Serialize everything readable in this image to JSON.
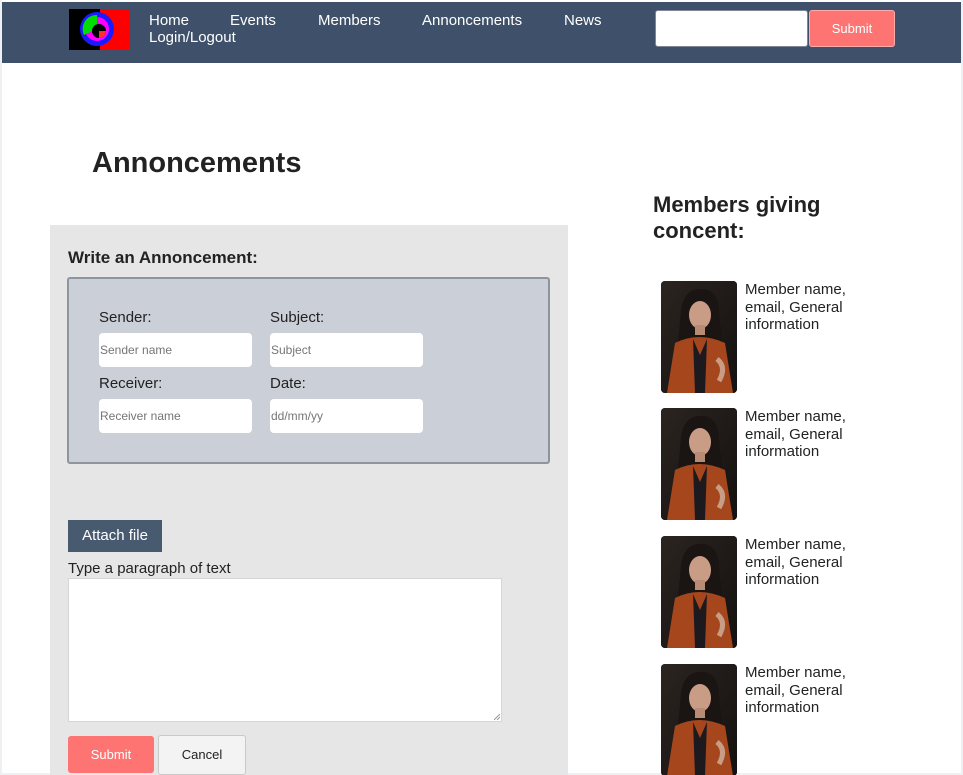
{
  "nav": {
    "links": [
      "Home",
      "Events",
      "Members",
      "Annoncements",
      "News",
      "Login/Logout"
    ],
    "submit_label": "Submit",
    "search_value": ""
  },
  "page": {
    "title": "Annoncements"
  },
  "form": {
    "title": "Write an Annoncement:",
    "sender_label": "Sender:",
    "sender_placeholder": "Sender name",
    "subject_label": "Subject:",
    "subject_placeholder": "Subject",
    "receiver_label": "Receiver:",
    "receiver_placeholder": "Receiver name",
    "date_label": "Date:",
    "date_placeholder": "dd/mm/yy",
    "attach_label": "Attach file",
    "textarea_label": "Type a paragraph of text",
    "submit_label": "Submit",
    "cancel_label": "Cancel"
  },
  "sidebar": {
    "title": "Members giving concent:",
    "members": [
      {
        "info": "Member name, email, General information"
      },
      {
        "info": "Member name, email, General information"
      },
      {
        "info": "Member name, email, General information"
      },
      {
        "info": "Member name, email, General information"
      }
    ]
  },
  "colors": {
    "navbar": "#3f516a",
    "accent": "#fd7472",
    "attach": "#485a70",
    "panel": "#e6e6e6",
    "fieldset": "#cbd0d8"
  }
}
